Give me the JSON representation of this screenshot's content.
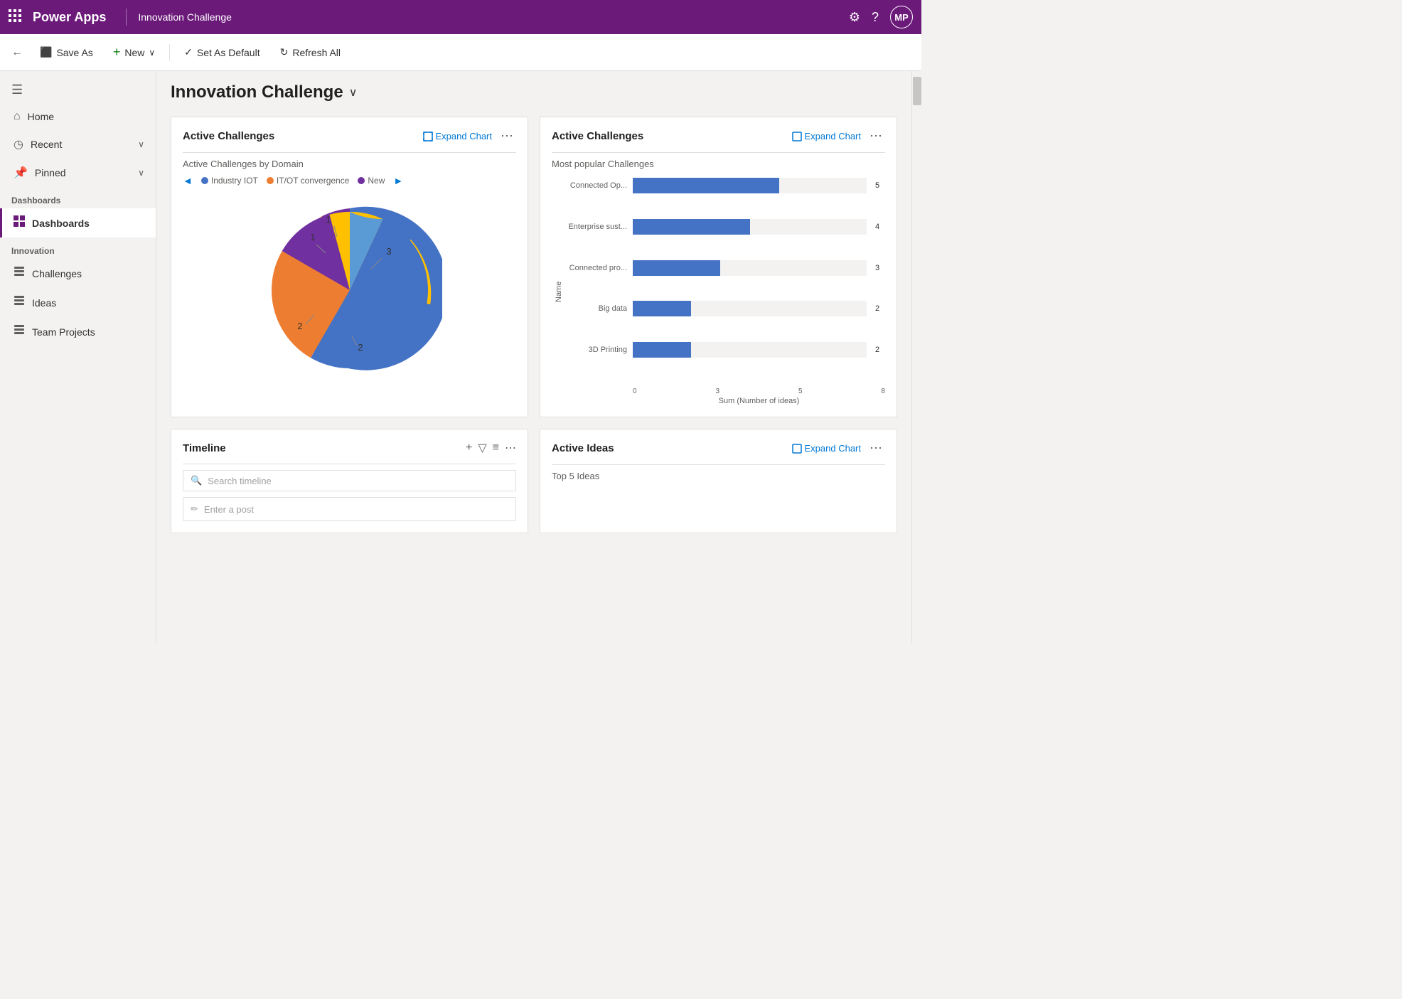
{
  "topNav": {
    "appName": "Power Apps",
    "pageTitle": "Innovation Challenge",
    "avatarInitials": "MP"
  },
  "toolbar": {
    "backLabel": "←",
    "saveAsLabel": "Save As",
    "newLabel": "New",
    "newDropdownLabel": "▾",
    "setDefaultLabel": "Set As Default",
    "refreshLabel": "Refresh All"
  },
  "pageHeading": {
    "title": "Innovation Challenge",
    "chevron": "∨"
  },
  "sidebar": {
    "hamburger": "☰",
    "navItems": [
      {
        "id": "home",
        "label": "Home",
        "icon": "⌂",
        "hasChevron": false
      },
      {
        "id": "recent",
        "label": "Recent",
        "icon": "◷",
        "hasChevron": true
      },
      {
        "id": "pinned",
        "label": "Pinned",
        "icon": "📌",
        "hasChevron": true
      }
    ],
    "sections": [
      {
        "label": "Dashboards",
        "items": [
          {
            "id": "dashboards",
            "label": "Dashboards",
            "icon": "▦",
            "active": true
          }
        ]
      },
      {
        "label": "Innovation",
        "items": [
          {
            "id": "challenges",
            "label": "Challenges",
            "icon": "☰",
            "active": false
          },
          {
            "id": "ideas",
            "label": "Ideas",
            "icon": "☰",
            "active": false
          },
          {
            "id": "team-projects",
            "label": "Team Projects",
            "icon": "☰",
            "active": false
          }
        ]
      }
    ]
  },
  "activeChallengesLeft": {
    "title": "Active Challenges",
    "expandLabel": "Expand Chart",
    "chartTitle": "Active Challenges by Domain",
    "legendItems": [
      {
        "label": "Industry IOT",
        "color": "#4472c4"
      },
      {
        "label": "IT/OT convergence",
        "color": "#ed7d31"
      },
      {
        "label": "New",
        "color": "#7030a0"
      }
    ],
    "pieData": [
      {
        "label": "3",
        "value": 3,
        "color": "#4472c4",
        "startAngle": -30,
        "endAngle": 120
      },
      {
        "label": "2",
        "value": 2,
        "color": "#ed7d31",
        "startAngle": 120,
        "endAngle": 210
      },
      {
        "label": "1",
        "value": 1,
        "color": "#7030a0",
        "startAngle": 210,
        "endAngle": 260
      },
      {
        "label": "1",
        "value": 1,
        "color": "#ffc000",
        "startAngle": 260,
        "endAngle": 310
      },
      {
        "label": "2",
        "value": 2,
        "color": "#5b9bd5",
        "startAngle": 310,
        "endAngle": 360
      }
    ]
  },
  "activeChallengesRight": {
    "title": "Active Challenges",
    "expandLabel": "Expand Chart",
    "chartTitle": "Most popular Challenges",
    "yAxisLabel": "Name",
    "xAxisLabel": "Sum (Number of ideas)",
    "bars": [
      {
        "label": "Connected Op...",
        "value": 5,
        "maxValue": 8
      },
      {
        "label": "Enterprise sust...",
        "value": 4,
        "maxValue": 8
      },
      {
        "label": "Connected pro...",
        "value": 3,
        "maxValue": 8
      },
      {
        "label": "Big data",
        "value": 2,
        "maxValue": 8
      },
      {
        "label": "3D Printing",
        "value": 2,
        "maxValue": 8
      }
    ],
    "xTicks": [
      "0",
      "3",
      "5",
      "8"
    ]
  },
  "timeline": {
    "title": "Timeline",
    "searchPlaceholder": "Search timeline",
    "postPlaceholder": "Enter a post"
  },
  "activeIdeas": {
    "title": "Active Ideas",
    "expandLabel": "Expand Chart",
    "chartTitle": "Top 5 Ideas"
  }
}
